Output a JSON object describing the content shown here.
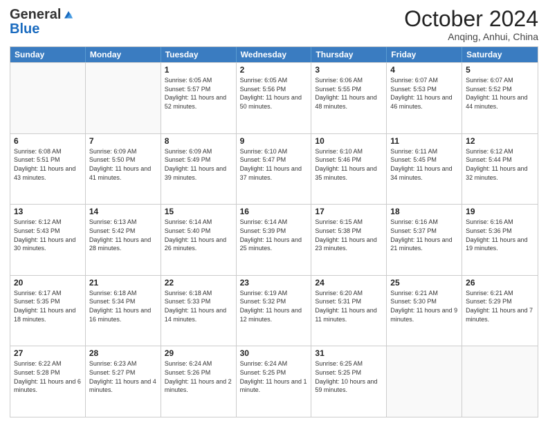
{
  "logo": {
    "general": "General",
    "blue": "Blue"
  },
  "title": "October 2024",
  "subtitle": "Anqing, Anhui, China",
  "header_days": [
    "Sunday",
    "Monday",
    "Tuesday",
    "Wednesday",
    "Thursday",
    "Friday",
    "Saturday"
  ],
  "weeks": [
    [
      {
        "day": "",
        "sunrise": "",
        "sunset": "",
        "daylight": ""
      },
      {
        "day": "",
        "sunrise": "",
        "sunset": "",
        "daylight": ""
      },
      {
        "day": "1",
        "sunrise": "Sunrise: 6:05 AM",
        "sunset": "Sunset: 5:57 PM",
        "daylight": "Daylight: 11 hours and 52 minutes."
      },
      {
        "day": "2",
        "sunrise": "Sunrise: 6:05 AM",
        "sunset": "Sunset: 5:56 PM",
        "daylight": "Daylight: 11 hours and 50 minutes."
      },
      {
        "day": "3",
        "sunrise": "Sunrise: 6:06 AM",
        "sunset": "Sunset: 5:55 PM",
        "daylight": "Daylight: 11 hours and 48 minutes."
      },
      {
        "day": "4",
        "sunrise": "Sunrise: 6:07 AM",
        "sunset": "Sunset: 5:53 PM",
        "daylight": "Daylight: 11 hours and 46 minutes."
      },
      {
        "day": "5",
        "sunrise": "Sunrise: 6:07 AM",
        "sunset": "Sunset: 5:52 PM",
        "daylight": "Daylight: 11 hours and 44 minutes."
      }
    ],
    [
      {
        "day": "6",
        "sunrise": "Sunrise: 6:08 AM",
        "sunset": "Sunset: 5:51 PM",
        "daylight": "Daylight: 11 hours and 43 minutes."
      },
      {
        "day": "7",
        "sunrise": "Sunrise: 6:09 AM",
        "sunset": "Sunset: 5:50 PM",
        "daylight": "Daylight: 11 hours and 41 minutes."
      },
      {
        "day": "8",
        "sunrise": "Sunrise: 6:09 AM",
        "sunset": "Sunset: 5:49 PM",
        "daylight": "Daylight: 11 hours and 39 minutes."
      },
      {
        "day": "9",
        "sunrise": "Sunrise: 6:10 AM",
        "sunset": "Sunset: 5:47 PM",
        "daylight": "Daylight: 11 hours and 37 minutes."
      },
      {
        "day": "10",
        "sunrise": "Sunrise: 6:10 AM",
        "sunset": "Sunset: 5:46 PM",
        "daylight": "Daylight: 11 hours and 35 minutes."
      },
      {
        "day": "11",
        "sunrise": "Sunrise: 6:11 AM",
        "sunset": "Sunset: 5:45 PM",
        "daylight": "Daylight: 11 hours and 34 minutes."
      },
      {
        "day": "12",
        "sunrise": "Sunrise: 6:12 AM",
        "sunset": "Sunset: 5:44 PM",
        "daylight": "Daylight: 11 hours and 32 minutes."
      }
    ],
    [
      {
        "day": "13",
        "sunrise": "Sunrise: 6:12 AM",
        "sunset": "Sunset: 5:43 PM",
        "daylight": "Daylight: 11 hours and 30 minutes."
      },
      {
        "day": "14",
        "sunrise": "Sunrise: 6:13 AM",
        "sunset": "Sunset: 5:42 PM",
        "daylight": "Daylight: 11 hours and 28 minutes."
      },
      {
        "day": "15",
        "sunrise": "Sunrise: 6:14 AM",
        "sunset": "Sunset: 5:40 PM",
        "daylight": "Daylight: 11 hours and 26 minutes."
      },
      {
        "day": "16",
        "sunrise": "Sunrise: 6:14 AM",
        "sunset": "Sunset: 5:39 PM",
        "daylight": "Daylight: 11 hours and 25 minutes."
      },
      {
        "day": "17",
        "sunrise": "Sunrise: 6:15 AM",
        "sunset": "Sunset: 5:38 PM",
        "daylight": "Daylight: 11 hours and 23 minutes."
      },
      {
        "day": "18",
        "sunrise": "Sunrise: 6:16 AM",
        "sunset": "Sunset: 5:37 PM",
        "daylight": "Daylight: 11 hours and 21 minutes."
      },
      {
        "day": "19",
        "sunrise": "Sunrise: 6:16 AM",
        "sunset": "Sunset: 5:36 PM",
        "daylight": "Daylight: 11 hours and 19 minutes."
      }
    ],
    [
      {
        "day": "20",
        "sunrise": "Sunrise: 6:17 AM",
        "sunset": "Sunset: 5:35 PM",
        "daylight": "Daylight: 11 hours and 18 minutes."
      },
      {
        "day": "21",
        "sunrise": "Sunrise: 6:18 AM",
        "sunset": "Sunset: 5:34 PM",
        "daylight": "Daylight: 11 hours and 16 minutes."
      },
      {
        "day": "22",
        "sunrise": "Sunrise: 6:18 AM",
        "sunset": "Sunset: 5:33 PM",
        "daylight": "Daylight: 11 hours and 14 minutes."
      },
      {
        "day": "23",
        "sunrise": "Sunrise: 6:19 AM",
        "sunset": "Sunset: 5:32 PM",
        "daylight": "Daylight: 11 hours and 12 minutes."
      },
      {
        "day": "24",
        "sunrise": "Sunrise: 6:20 AM",
        "sunset": "Sunset: 5:31 PM",
        "daylight": "Daylight: 11 hours and 11 minutes."
      },
      {
        "day": "25",
        "sunrise": "Sunrise: 6:21 AM",
        "sunset": "Sunset: 5:30 PM",
        "daylight": "Daylight: 11 hours and 9 minutes."
      },
      {
        "day": "26",
        "sunrise": "Sunrise: 6:21 AM",
        "sunset": "Sunset: 5:29 PM",
        "daylight": "Daylight: 11 hours and 7 minutes."
      }
    ],
    [
      {
        "day": "27",
        "sunrise": "Sunrise: 6:22 AM",
        "sunset": "Sunset: 5:28 PM",
        "daylight": "Daylight: 11 hours and 6 minutes."
      },
      {
        "day": "28",
        "sunrise": "Sunrise: 6:23 AM",
        "sunset": "Sunset: 5:27 PM",
        "daylight": "Daylight: 11 hours and 4 minutes."
      },
      {
        "day": "29",
        "sunrise": "Sunrise: 6:24 AM",
        "sunset": "Sunset: 5:26 PM",
        "daylight": "Daylight: 11 hours and 2 minutes."
      },
      {
        "day": "30",
        "sunrise": "Sunrise: 6:24 AM",
        "sunset": "Sunset: 5:25 PM",
        "daylight": "Daylight: 11 hours and 1 minute."
      },
      {
        "day": "31",
        "sunrise": "Sunrise: 6:25 AM",
        "sunset": "Sunset: 5:25 PM",
        "daylight": "Daylight: 10 hours and 59 minutes."
      },
      {
        "day": "",
        "sunrise": "",
        "sunset": "",
        "daylight": ""
      },
      {
        "day": "",
        "sunrise": "",
        "sunset": "",
        "daylight": ""
      }
    ]
  ]
}
